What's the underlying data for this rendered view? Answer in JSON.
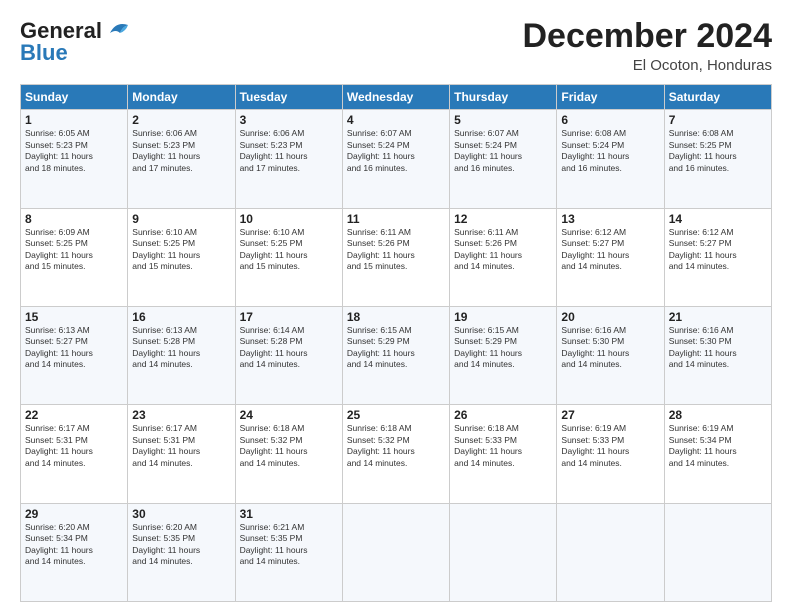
{
  "logo": {
    "line1": "General",
    "line2": "Blue"
  },
  "title": "December 2024",
  "location": "El Ocoton, Honduras",
  "days_of_week": [
    "Sunday",
    "Monday",
    "Tuesday",
    "Wednesday",
    "Thursday",
    "Friday",
    "Saturday"
  ],
  "weeks": [
    [
      {
        "day": 1,
        "info": "Sunrise: 6:05 AM\nSunset: 5:23 PM\nDaylight: 11 hours\nand 18 minutes."
      },
      {
        "day": 2,
        "info": "Sunrise: 6:06 AM\nSunset: 5:23 PM\nDaylight: 11 hours\nand 17 minutes."
      },
      {
        "day": 3,
        "info": "Sunrise: 6:06 AM\nSunset: 5:23 PM\nDaylight: 11 hours\nand 17 minutes."
      },
      {
        "day": 4,
        "info": "Sunrise: 6:07 AM\nSunset: 5:24 PM\nDaylight: 11 hours\nand 16 minutes."
      },
      {
        "day": 5,
        "info": "Sunrise: 6:07 AM\nSunset: 5:24 PM\nDaylight: 11 hours\nand 16 minutes."
      },
      {
        "day": 6,
        "info": "Sunrise: 6:08 AM\nSunset: 5:24 PM\nDaylight: 11 hours\nand 16 minutes."
      },
      {
        "day": 7,
        "info": "Sunrise: 6:08 AM\nSunset: 5:25 PM\nDaylight: 11 hours\nand 16 minutes."
      }
    ],
    [
      {
        "day": 8,
        "info": "Sunrise: 6:09 AM\nSunset: 5:25 PM\nDaylight: 11 hours\nand 15 minutes."
      },
      {
        "day": 9,
        "info": "Sunrise: 6:10 AM\nSunset: 5:25 PM\nDaylight: 11 hours\nand 15 minutes."
      },
      {
        "day": 10,
        "info": "Sunrise: 6:10 AM\nSunset: 5:25 PM\nDaylight: 11 hours\nand 15 minutes."
      },
      {
        "day": 11,
        "info": "Sunrise: 6:11 AM\nSunset: 5:26 PM\nDaylight: 11 hours\nand 15 minutes."
      },
      {
        "day": 12,
        "info": "Sunrise: 6:11 AM\nSunset: 5:26 PM\nDaylight: 11 hours\nand 14 minutes."
      },
      {
        "day": 13,
        "info": "Sunrise: 6:12 AM\nSunset: 5:27 PM\nDaylight: 11 hours\nand 14 minutes."
      },
      {
        "day": 14,
        "info": "Sunrise: 6:12 AM\nSunset: 5:27 PM\nDaylight: 11 hours\nand 14 minutes."
      }
    ],
    [
      {
        "day": 15,
        "info": "Sunrise: 6:13 AM\nSunset: 5:27 PM\nDaylight: 11 hours\nand 14 minutes."
      },
      {
        "day": 16,
        "info": "Sunrise: 6:13 AM\nSunset: 5:28 PM\nDaylight: 11 hours\nand 14 minutes."
      },
      {
        "day": 17,
        "info": "Sunrise: 6:14 AM\nSunset: 5:28 PM\nDaylight: 11 hours\nand 14 minutes."
      },
      {
        "day": 18,
        "info": "Sunrise: 6:15 AM\nSunset: 5:29 PM\nDaylight: 11 hours\nand 14 minutes."
      },
      {
        "day": 19,
        "info": "Sunrise: 6:15 AM\nSunset: 5:29 PM\nDaylight: 11 hours\nand 14 minutes."
      },
      {
        "day": 20,
        "info": "Sunrise: 6:16 AM\nSunset: 5:30 PM\nDaylight: 11 hours\nand 14 minutes."
      },
      {
        "day": 21,
        "info": "Sunrise: 6:16 AM\nSunset: 5:30 PM\nDaylight: 11 hours\nand 14 minutes."
      }
    ],
    [
      {
        "day": 22,
        "info": "Sunrise: 6:17 AM\nSunset: 5:31 PM\nDaylight: 11 hours\nand 14 minutes."
      },
      {
        "day": 23,
        "info": "Sunrise: 6:17 AM\nSunset: 5:31 PM\nDaylight: 11 hours\nand 14 minutes."
      },
      {
        "day": 24,
        "info": "Sunrise: 6:18 AM\nSunset: 5:32 PM\nDaylight: 11 hours\nand 14 minutes."
      },
      {
        "day": 25,
        "info": "Sunrise: 6:18 AM\nSunset: 5:32 PM\nDaylight: 11 hours\nand 14 minutes."
      },
      {
        "day": 26,
        "info": "Sunrise: 6:18 AM\nSunset: 5:33 PM\nDaylight: 11 hours\nand 14 minutes."
      },
      {
        "day": 27,
        "info": "Sunrise: 6:19 AM\nSunset: 5:33 PM\nDaylight: 11 hours\nand 14 minutes."
      },
      {
        "day": 28,
        "info": "Sunrise: 6:19 AM\nSunset: 5:34 PM\nDaylight: 11 hours\nand 14 minutes."
      }
    ],
    [
      {
        "day": 29,
        "info": "Sunrise: 6:20 AM\nSunset: 5:34 PM\nDaylight: 11 hours\nand 14 minutes."
      },
      {
        "day": 30,
        "info": "Sunrise: 6:20 AM\nSunset: 5:35 PM\nDaylight: 11 hours\nand 14 minutes."
      },
      {
        "day": 31,
        "info": "Sunrise: 6:21 AM\nSunset: 5:35 PM\nDaylight: 11 hours\nand 14 minutes."
      },
      null,
      null,
      null,
      null
    ]
  ]
}
